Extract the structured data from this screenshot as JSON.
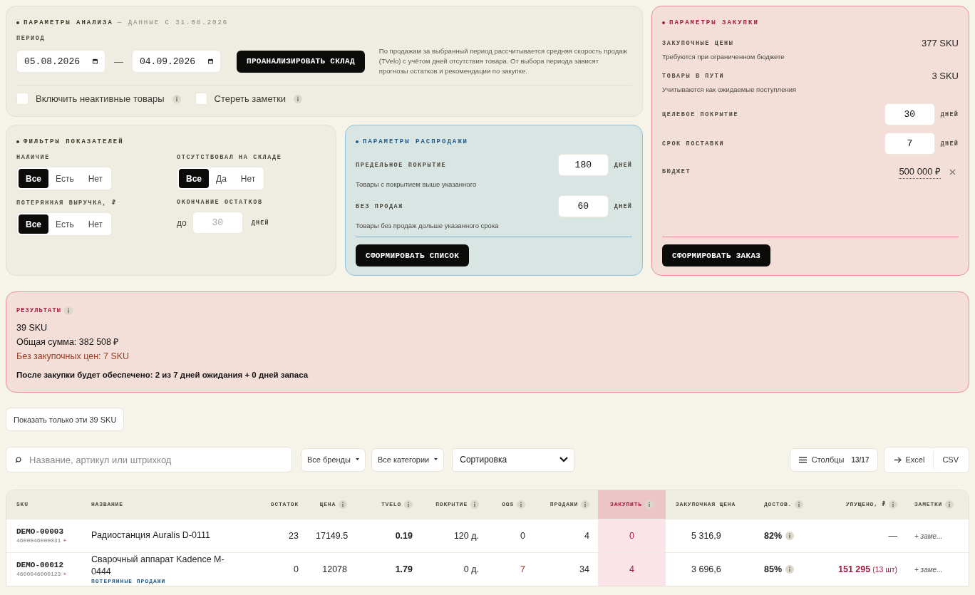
{
  "analysis": {
    "title": "ПАРАМЕТРЫ АНАЛИЗА",
    "subtitle": "— ДАННЫЕ С 31.08.2026",
    "period_label": "ПЕРИОД",
    "date_from": "05.08.2026",
    "separator": "—",
    "date_to": "04.09.2026",
    "button": "ПРОАНАЛИЗИРОВАТЬ СКЛАД",
    "note": "По продажам за выбранный период рассчитывается средняя скорость продаж (TVelo) с учётом дней отсутствия товара. От выбора периода зависят прогнозы остатков и рекомендации по закупке.",
    "checkboxes": [
      {
        "label": "Включить неактивные товары",
        "checked": false
      },
      {
        "label": "Стереть заметки",
        "checked": false
      }
    ]
  },
  "filters": {
    "title": "ФИЛЬТРЫ ПОКАЗАТЕЛЕЙ",
    "groups": [
      {
        "kind": "segmented",
        "label": "НАЛИЧИЕ",
        "options": [
          {
            "label": "Все",
            "selected": true
          },
          {
            "label": "Есть",
            "selected": false
          },
          {
            "label": "Нет",
            "selected": false
          }
        ]
      },
      {
        "kind": "segmented",
        "label": "ОТСУТСТВОВАЛ НА СКЛАДЕ",
        "options": [
          {
            "label": "Все",
            "selected": true
          },
          {
            "label": "Да",
            "selected": false
          },
          {
            "label": "Нет",
            "selected": false
          }
        ]
      },
      {
        "kind": "segmented",
        "label": "ПОТЕРЯННАЯ ВЫРУЧКА, ₽",
        "options": [
          {
            "label": "Все",
            "selected": true
          },
          {
            "label": "Есть",
            "selected": false
          },
          {
            "label": "Нет",
            "selected": false
          }
        ]
      },
      {
        "kind": "limit",
        "label": "ОКОНЧАНИЕ ОСТАТКОВ",
        "prefix": "до",
        "placeholder": "30",
        "unit": "ДНЕЙ"
      }
    ]
  },
  "sale": {
    "title": "ПАРАМЕТРЫ РАСПРОДАЖИ",
    "fields": [
      {
        "label": "ПРЕДЕЛЬНОЕ ПОКРЫТИЕ",
        "value": "180",
        "unit": "ДНЕЙ",
        "hint": "Товары с покрытием выше указанного"
      },
      {
        "label": "БЕЗ ПРОДАЖ",
        "value": "60",
        "unit": "ДНЕЙ",
        "hint": "Товары без продаж дольше указанного срока"
      }
    ],
    "button": "СФОРМИРОВАТЬ СПИСОК"
  },
  "purchase": {
    "title": "ПАРАМЕТРЫ ЗАКУПКИ",
    "rows": [
      {
        "kind": "info",
        "label": "ЗАКУПОЧНЫЕ ЦЕНЫ",
        "value": "377 SKU",
        "hint": "Требуются при ограниченном бюджете"
      },
      {
        "kind": "info",
        "label": "ТОВАРЫ В ПУТИ",
        "value": "3 SKU",
        "hint": "Учитываются как ожидаемые поступления"
      },
      {
        "kind": "input",
        "label": "ЦЕЛЕВОЕ ПОКРЫТИЕ",
        "value": "30",
        "unit": "ДНЕЙ"
      },
      {
        "kind": "input",
        "label": "СРОК ПОСТАВКИ",
        "value": "7",
        "unit": "ДНЕЙ"
      },
      {
        "kind": "budget",
        "label": "БЮДЖЕТ",
        "value": "500 000 ₽"
      }
    ],
    "button": "СФОРМИРОВАТЬ ЗАКАЗ"
  },
  "results": {
    "title": "РЕЗУЛЬТАТЫ",
    "lines": [
      {
        "kind": "normal",
        "text": "39 SKU"
      },
      {
        "kind": "normal",
        "text": "Общая сумма: 382 508 ₽"
      },
      {
        "kind": "warning",
        "text": "Без закупочных цен: 7 SKU"
      },
      {
        "kind": "strong",
        "text": "После закупки будет обеспечено: 2 из 7 дней ожидания + 0 дней запаса"
      }
    ]
  },
  "show_button": "Показать только эти 39 SKU",
  "toolbar": {
    "search_placeholder": "Название, артикул или штрихкод",
    "brand_filter": "Все бренды",
    "category_filter": "Все категории",
    "sort": "Сортировка",
    "columns_button": "Столбцы",
    "columns_count": "13/17",
    "export": [
      "Excel",
      "CSV"
    ]
  },
  "table": {
    "columns": [
      {
        "kind": "sku",
        "label": "SKU",
        "info": false,
        "highlight": false
      },
      {
        "kind": "name",
        "label": "НАЗВАНИЕ",
        "info": false,
        "highlight": false
      },
      {
        "kind": "stock",
        "label": "ОСТАТОК",
        "info": false,
        "highlight": false
      },
      {
        "kind": "price",
        "label": "ЦЕНА",
        "info": true,
        "highlight": false
      },
      {
        "kind": "tvelo",
        "label": "TVELO",
        "info": true,
        "highlight": false
      },
      {
        "kind": "coverage",
        "label": "ПОКРЫТИЕ",
        "info": true,
        "highlight": false
      },
      {
        "kind": "oos",
        "label": "OOS",
        "info": true,
        "highlight": false
      },
      {
        "kind": "sales",
        "label": "ПРОДАЖИ",
        "info": true,
        "highlight": false
      },
      {
        "kind": "buy",
        "label": "ЗАКУПИТЬ",
        "info": true,
        "highlight": true
      },
      {
        "kind": "cost",
        "label": "ЗАКУПОЧНАЯ ЦЕНА",
        "info": false,
        "highlight": false
      },
      {
        "kind": "delivery",
        "label": "ДОСТОВ.",
        "info": true,
        "highlight": false
      },
      {
        "kind": "lost",
        "label": "УПУЩЕНО, ₽",
        "info": true,
        "highlight": false
      },
      {
        "kind": "note",
        "label": "ЗАМЕТКИ",
        "info": true,
        "highlight": false
      }
    ],
    "rows": [
      {
        "sku": "DEMO-00003",
        "barcode": "4600046000031",
        "barcode_add": "+",
        "name": "Радиостанция Auralis D-0111",
        "stock": "23",
        "price": "17149.5",
        "tvelo": "0.19",
        "coverage": "120 д.",
        "oos": "0",
        "oos_alert": false,
        "sales": "4",
        "buy": "0",
        "cost": "5 316,9",
        "delivery": "82%",
        "lost": "—",
        "lost_alert": false,
        "note": "+ заме..."
      },
      {
        "sku": "DEMO-00012",
        "barcode": "4600046000123",
        "barcode_add": "+",
        "name": "Сварочный аппарат Kadence M-0444",
        "tag": "ПОТЕРЯННЫЕ ПРОДАЖИ",
        "stock": "0",
        "price": "12078",
        "tvelo": "1.79",
        "coverage": "0 д.",
        "oos": "7",
        "oos_alert": true,
        "sales": "34",
        "buy": "4",
        "cost": "3 696,6",
        "delivery": "85%",
        "lost": "151 295",
        "lost_qty": "(13 шт)",
        "lost_alert": true,
        "note": "+ заме..."
      }
    ]
  }
}
